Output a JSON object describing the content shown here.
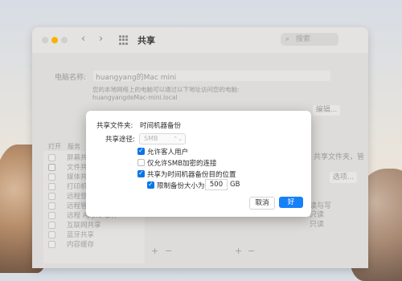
{
  "window": {
    "title": "共享",
    "search_placeholder": "搜索",
    "traffic_lights": [
      "close",
      "minimize",
      "zoom"
    ],
    "accent_minimize": "#f5b400"
  },
  "background": {
    "computer_name_label": "电脑名称:",
    "computer_name_value": "huangyang的Mac mini",
    "info_line1": "您的本地网络上的电脑可以通过以下地址访问您的电脑:",
    "info_line2": "huangyangdeMac-mini.local",
    "edit_button": "编辑...",
    "col_on": "打开",
    "col_service": "服务",
    "services": [
      {
        "label": "屏幕共享",
        "checked": false
      },
      {
        "label": "文件共享",
        "checked": true
      },
      {
        "label": "媒体共享",
        "checked": false
      },
      {
        "label": "打印机共享",
        "checked": false
      },
      {
        "label": "远程登录",
        "checked": false
      },
      {
        "label": "远程管理",
        "checked": false
      },
      {
        "label": "远程 Apple 事件",
        "checked": false
      },
      {
        "label": "互联网共享",
        "checked": false
      },
      {
        "label": "蓝牙共享",
        "checked": false
      },
      {
        "label": "内容缓存",
        "checked": false
      }
    ],
    "options_button": "选项...",
    "right_text": "共享文件夹，管",
    "perm1": "读与写",
    "perm2": "只读",
    "perm3": "只读",
    "add_label": "+",
    "remove_label": "−"
  },
  "sheet": {
    "shared_folder_label": "共享文件夹:",
    "shared_folder_value": "时间机器备份",
    "share_path_label": "共享途径:",
    "share_path_value": "SMB",
    "options": [
      {
        "label": "允许客人用户",
        "checked": true
      },
      {
        "label": "仅允许SMB加密的连接",
        "checked": false
      },
      {
        "label": "共享为时间机器备份目的位置",
        "checked": true
      }
    ],
    "limit_label": "限制备份大小为",
    "limit_checked": true,
    "limit_value": "500",
    "limit_unit": "GB",
    "cancel_button": "取消",
    "ok_button": "好",
    "accent": "#1680f7"
  }
}
